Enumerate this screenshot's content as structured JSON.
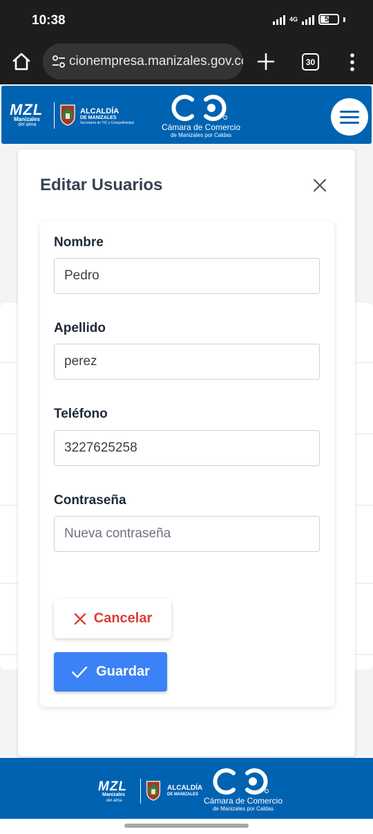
{
  "status_bar": {
    "time": "10:38",
    "network": "4G",
    "battery": "51",
    "battery_level_percent": 51
  },
  "browser": {
    "url": "cionempresa.manizales.gov.co",
    "tab_count": "30",
    "icons": [
      "home-icon",
      "site-settings-icon",
      "new-tab-plus-icon",
      "tab-switcher-icon",
      "overflow-menu-icon"
    ]
  },
  "header": {
    "mzl_text": "MZL",
    "mzl_sub": "Manizales",
    "mzl_tagline": "del alma",
    "alcaldia_title": "ALCALDÍA",
    "alcaldia_sub": "DE MANIZALES",
    "alcaldia_detail": "Secretaría de TIC y Competitividad",
    "camara_title": "Cámara de Comercio",
    "camara_sub": "de Manizales por Caldas",
    "accent_color": "#0063b1"
  },
  "modal": {
    "title": "Editar Usuarios",
    "fields": {
      "nombre": {
        "label": "Nombre",
        "value": "Pedro"
      },
      "apellido": {
        "label": "Apellido",
        "value": "perez"
      },
      "telefono": {
        "label": "Teléfono",
        "value": "3227625258"
      },
      "contrasena": {
        "label": "Contraseña",
        "value": "",
        "placeholder": "Nueva contraseña"
      }
    },
    "cancel_label": "Cancelar",
    "save_label": "Guardar",
    "cancel_color": "#dc3d36",
    "save_color": "#3b82f6"
  },
  "footer": {
    "mzl_text": "MZL",
    "mzl_sub": "Manizales",
    "mzl_tagline": "del alma",
    "alcaldia_title": "ALCALDÍA",
    "alcaldia_sub": "DE MANIZALES",
    "camara_title": "Cámara de Comercio",
    "camara_sub": "de Manizales por Caldas"
  }
}
